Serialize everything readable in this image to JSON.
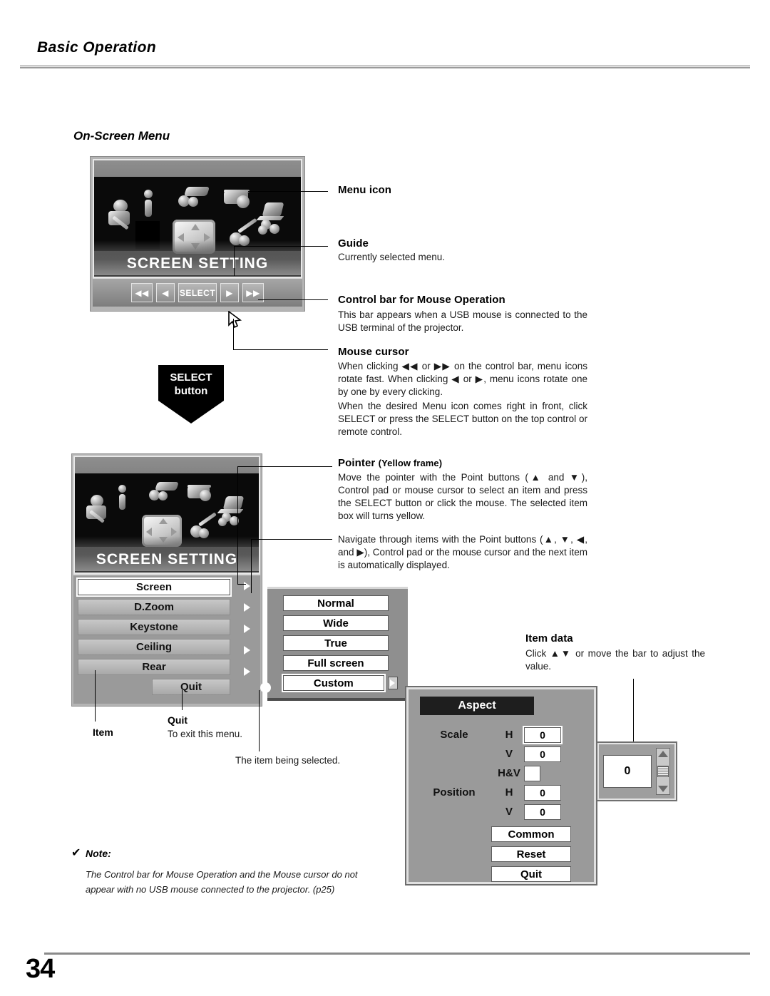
{
  "header": {
    "title": "Basic Operation"
  },
  "footer": {
    "page_number": "34"
  },
  "section": {
    "heading": "On-Screen Menu"
  },
  "screen1": {
    "title": "SCREEN SETTING",
    "control_bar": {
      "buttons": [
        "◀◀",
        "◀",
        "SELECT",
        "▶",
        "▶▶"
      ]
    }
  },
  "select_button": {
    "line1": "SELECT",
    "line2": "button"
  },
  "screen2": {
    "title": "SCREEN SETTING",
    "menu_items": [
      "Screen",
      "D.Zoom",
      "Keystone",
      "Ceiling",
      "Rear"
    ],
    "selected_item": "Screen",
    "quit_label": "Quit"
  },
  "submenu": {
    "items": [
      "Normal",
      "Wide",
      "True",
      "Full screen",
      "Custom"
    ],
    "selected_item": "Custom"
  },
  "aspect_dialog": {
    "title": "Aspect",
    "rows": [
      {
        "group": "Scale",
        "axis": "H",
        "value": "0",
        "selected": true
      },
      {
        "group": "",
        "axis": "V",
        "value": "0",
        "selected": false
      },
      {
        "group": "",
        "axis": "H&V",
        "value": "",
        "selected": false
      },
      {
        "group": "Position",
        "axis": "H",
        "value": "0",
        "selected": false
      },
      {
        "group": "",
        "axis": "V",
        "value": "0",
        "selected": false
      }
    ],
    "buttons": [
      "Common",
      "Reset",
      "Quit"
    ]
  },
  "value_adjuster": {
    "value": "0"
  },
  "callouts": {
    "menu_icon": {
      "heading": "Menu icon",
      "body": ""
    },
    "guide": {
      "heading": "Guide",
      "body": "Currently selected menu."
    },
    "control_bar": {
      "heading": "Control bar for Mouse Operation",
      "body": "This bar appears when a USB mouse is connected to the USB terminal of the projector."
    },
    "mouse_cursor": {
      "heading": "Mouse cursor",
      "para1_a": "When clicking ",
      "para1_b": " or ",
      "para1_c": " on the control bar, menu icons rotate fast. When clicking ",
      "para1_d": " or ",
      "para1_e": ", menu icons rotate one by one by every clicking.",
      "para2": "When the desired Menu icon comes right in front, click SELECT or press the SELECT button on the top control or remote control."
    },
    "pointer": {
      "heading": "Pointer",
      "heading_sub": "(Yellow frame)",
      "para1_a": "Move the pointer with the Point buttons (",
      "para1_b": " and ",
      "para1_c": "), Control pad or mouse cursor to select an item and press the SELECT button or click the mouse. The selected item box will turns yellow."
    },
    "navigate": {
      "text_a": "Navigate through items with the Point buttons (",
      "text_b": ", ",
      "text_c": ", ",
      "text_d": ", and ",
      "text_e": "), Control pad or the mouse cursor and the next item is automatically displayed."
    },
    "item_data": {
      "heading": "Item data",
      "body_a": "Click ",
      "body_b": " or move the bar to adjust the value."
    },
    "item": {
      "label": "Item"
    },
    "quit": {
      "heading": "Quit",
      "body": "To exit this menu."
    },
    "being_selected": {
      "text": "The item being selected."
    }
  },
  "note": {
    "check": "✔",
    "label": "Note:",
    "line1": "The Control bar for Mouse Operation and the Mouse cursor do not",
    "line2": "appear with no USB mouse connected to the projector. (p25)"
  },
  "glyphs": {
    "left_double": "◀◀",
    "right_double": "▶▶",
    "left": "◀",
    "right": "▶",
    "up": "▲",
    "down": "▼"
  },
  "colors": {
    "page_bg": "#ffffff",
    "text": "#000000",
    "osd_panel": "#9a9a9a",
    "osd_dark": "#0a0a0a",
    "aspect_title_bg": "#1e1e1e",
    "rule": "#8a8a8a"
  }
}
